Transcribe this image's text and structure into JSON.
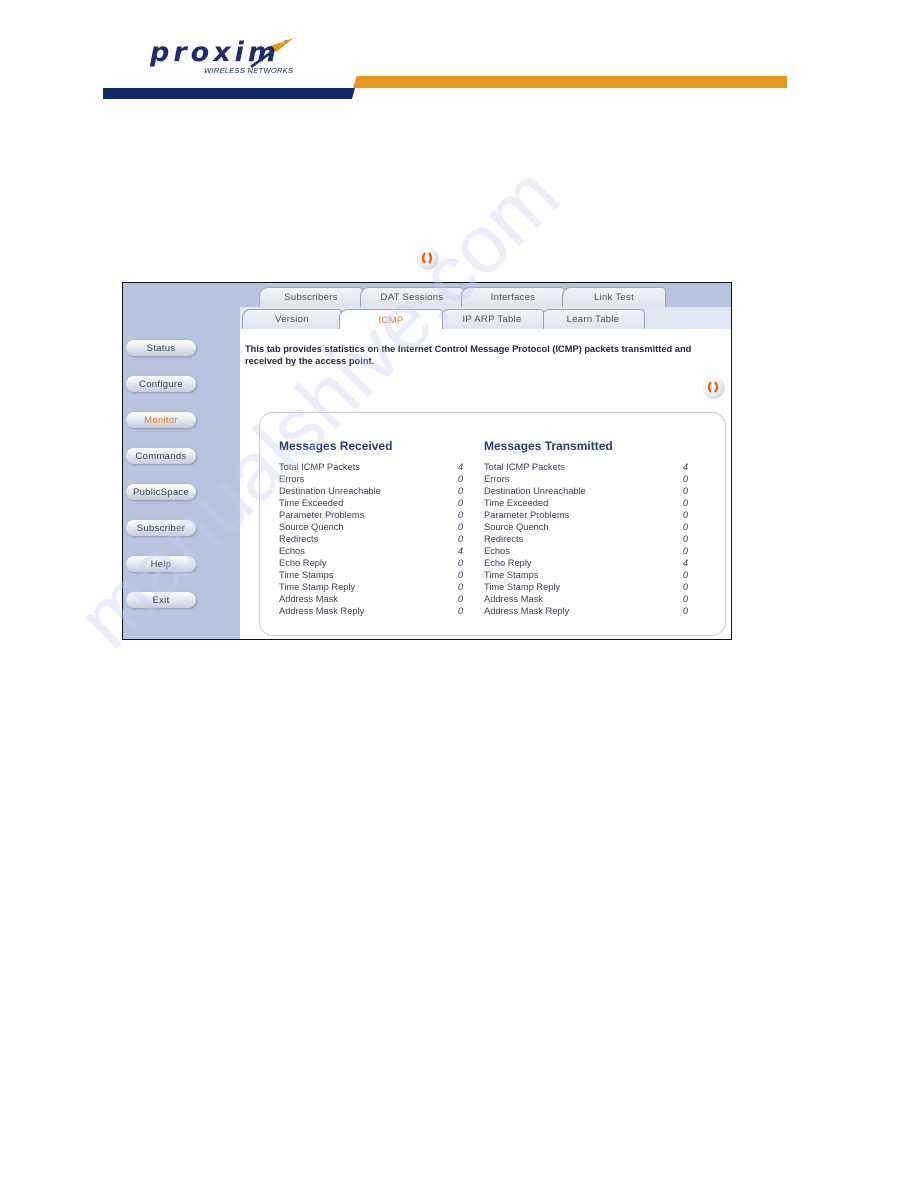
{
  "brand": {
    "logo_text": "proxim",
    "logo_subtitle": "WIRELESS NETWORKS",
    "colors": {
      "navy": "#0f2a66",
      "orange": "#e8961e",
      "accent_text": "#e8781e"
    }
  },
  "icons": {
    "refresh": "refresh-icon"
  },
  "sidebar": {
    "items": [
      {
        "label": "Status"
      },
      {
        "label": "Configure"
      },
      {
        "label": "Monitor",
        "active": true
      },
      {
        "label": "Commands"
      },
      {
        "label": "PublicSpace"
      },
      {
        "label": "Subscriber"
      },
      {
        "label": "Help"
      },
      {
        "label": "Exit"
      }
    ]
  },
  "tabs": {
    "upper": [
      {
        "label": "Subscribers"
      },
      {
        "label": "DAT Sessions"
      },
      {
        "label": "Interfaces"
      },
      {
        "label": "Link Test"
      }
    ],
    "lower": [
      {
        "label": "Version"
      },
      {
        "label": "ICMP",
        "active": true
      },
      {
        "label": "IP ARP Table"
      },
      {
        "label": "Learn Table"
      }
    ]
  },
  "content": {
    "description": "This tab provides statistics on the Internet Control Message Protocol (ICMP) packets transmitted and received by the access point.",
    "received": {
      "heading": "Messages Received",
      "rows": [
        {
          "label": "Total ICMP Packets",
          "value": "4"
        },
        {
          "label": "Errors",
          "value": "0"
        },
        {
          "label": "Destination Unreachable",
          "value": "0"
        },
        {
          "label": "Time Exceeded",
          "value": "0"
        },
        {
          "label": "Parameter Problems",
          "value": "0"
        },
        {
          "label": "Source Quench",
          "value": "0"
        },
        {
          "label": "Redirects",
          "value": "0"
        },
        {
          "label": "Echos",
          "value": "4"
        },
        {
          "label": "Echo Reply",
          "value": "0"
        },
        {
          "label": "Time Stamps",
          "value": "0"
        },
        {
          "label": "Time Stamp Reply",
          "value": "0"
        },
        {
          "label": "Address Mask",
          "value": "0"
        },
        {
          "label": "Address Mask Reply",
          "value": "0"
        }
      ]
    },
    "transmitted": {
      "heading": "Messages Transmitted",
      "rows": [
        {
          "label": "Total ICMP Packets",
          "value": "4"
        },
        {
          "label": "Errors",
          "value": "0"
        },
        {
          "label": "Destination Unreachable",
          "value": "0"
        },
        {
          "label": "Time Exceeded",
          "value": "0"
        },
        {
          "label": "Parameter Problems",
          "value": "0"
        },
        {
          "label": "Source Quench",
          "value": "0"
        },
        {
          "label": "Redirects",
          "value": "0"
        },
        {
          "label": "Echos",
          "value": "0"
        },
        {
          "label": "Echo Reply",
          "value": "4"
        },
        {
          "label": "Time Stamps",
          "value": "0"
        },
        {
          "label": "Time Stamp Reply",
          "value": "0"
        },
        {
          "label": "Address Mask",
          "value": "0"
        },
        {
          "label": "Address Mask Reply",
          "value": "0"
        }
      ]
    }
  },
  "watermark": "manualshive.com"
}
